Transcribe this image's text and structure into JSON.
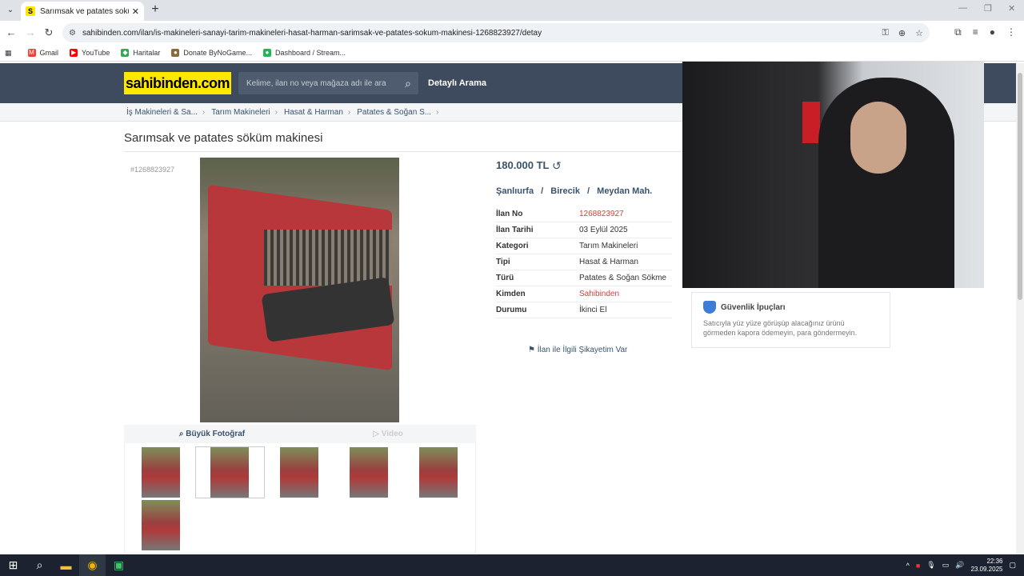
{
  "browser": {
    "tab_title": "Sarımsak ve patates sokum mak",
    "tab_favicon": "S",
    "url": "sahibinden.com/ilan/is-makineleri-sanayi-tarim-makineleri-hasat-harman-sarimsak-ve-patates-sokum-makinesi-1268823927/detay",
    "bookmarks": [
      "Gmail",
      "YouTube",
      "Haritalar",
      "Donate ByNoGame...",
      "Dashboard / Stream..."
    ]
  },
  "site": {
    "logo": "sahibinden.com",
    "search_placeholder": "Kelime, ilan no veya mağaza adı ile ara",
    "detailed_search": "Detaylı Arama"
  },
  "breadcrumb": [
    "İş Makineleri & Sa...",
    "Tarım Makineleri",
    "Hasat & Harman",
    "Patates & Soğan S..."
  ],
  "listing": {
    "title": "Sarımsak ve patates söküm makinesi",
    "small_id": "#1268823927",
    "price": "180.000 TL",
    "location": [
      "Şanlıurfa",
      "/",
      "Birecik",
      "/",
      "Meydan Mah."
    ],
    "details": [
      {
        "label": "İlan No",
        "value": "1268823927",
        "red": true
      },
      {
        "label": "İlan Tarihi",
        "value": "03 Eylül 2025",
        "red": false
      },
      {
        "label": "Kategori",
        "value": "Tarım Makineleri",
        "red": false
      },
      {
        "label": "Tipi",
        "value": "Hasat & Harman",
        "red": false
      },
      {
        "label": "Türü",
        "value": "Patates & Soğan Sökme",
        "red": false
      },
      {
        "label": "Kimden",
        "value": "Sahibinden",
        "red": true
      },
      {
        "label": "Durumu",
        "value": "İkinci El",
        "red": false
      }
    ],
    "complaint": "İlan ile İlgili Şikayetim Var",
    "photo_tabs": {
      "big": "Büyük Fotoğraf",
      "video": "Video"
    }
  },
  "security_tips": {
    "title": "Güvenlik İpuçları",
    "body": "Satıcıyla yüz yüze görüşüp alacağınız ürünü görmeden kapora ödemeyin, para göndermeyin."
  },
  "taskbar": {
    "time": "22:36",
    "date": "23.09.2025"
  }
}
